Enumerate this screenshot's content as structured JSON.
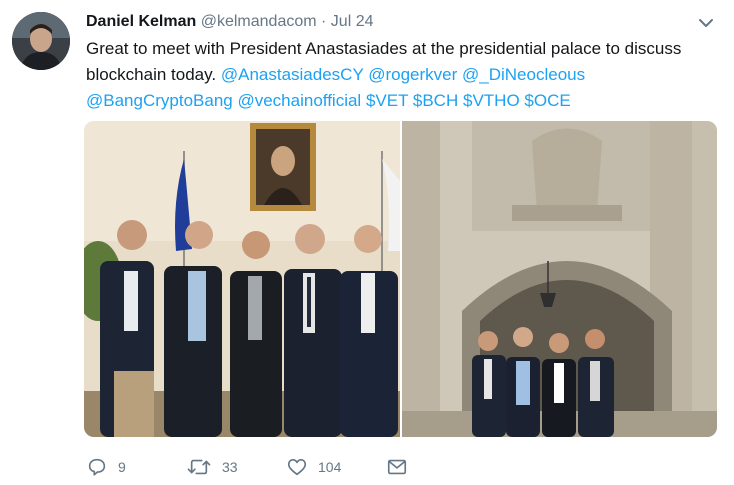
{
  "tweet": {
    "author_name": "Daniel Kelman",
    "author_handle": "@kelmandacom",
    "separator": "·",
    "date": "Jul 24",
    "text_plain": "Great to meet with President Anastasiades at the presidential palace to discuss blockchain today.",
    "mentions": [
      "@AnastasiadesCY",
      "@rogerkver",
      "@_DiNeocleous",
      "@BangCryptoBang",
      "@vechainofficial"
    ],
    "cashtags": [
      "$VET",
      "$BCH",
      "$VTHO",
      "$OCE"
    ]
  },
  "actions": {
    "reply_count": "9",
    "retweet_count": "33",
    "like_count": "104"
  },
  "colors": {
    "link": "#1da1f2",
    "muted": "#657786",
    "text": "#14171a"
  },
  "icons": [
    "chevron-down-icon",
    "reply-icon",
    "retweet-icon",
    "like-icon",
    "message-icon"
  ]
}
